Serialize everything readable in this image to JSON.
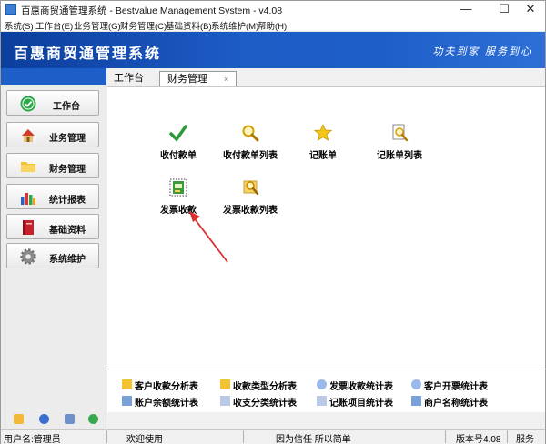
{
  "window": {
    "title": "百惠商贸通管理系统 - Bestvalue Management System - v4.08",
    "controls": {
      "minimize": "—",
      "maximize": "☐",
      "close": "✕"
    }
  },
  "menu": {
    "items": [
      "系统(S)",
      "工作台(E)",
      "业务管理(G)",
      "财务管理(C)",
      "基础资料(B)",
      "系统维护(M)",
      "帮助(H)"
    ]
  },
  "banner": {
    "app_title": "百惠商贸通管理系统",
    "slogan": "功夫到家 服务到心"
  },
  "sidebar": {
    "items": [
      {
        "label": "工作台",
        "icon": "check-circle-icon"
      },
      {
        "label": "业务管理",
        "icon": "house-icon"
      },
      {
        "label": "财务管理",
        "icon": "folder-icon"
      },
      {
        "label": "统计报表",
        "icon": "bar-chart-icon"
      },
      {
        "label": "基础资料",
        "icon": "book-icon"
      },
      {
        "label": "系统维护",
        "icon": "gear-icon"
      }
    ],
    "bottom_icons": [
      "note-icon",
      "clock-icon",
      "window-icon",
      "refresh-icon"
    ]
  },
  "tabs": {
    "workbench": "工作台",
    "finance": "财务管理",
    "close_symbol": "×"
  },
  "tiles": [
    {
      "label": "收付款单",
      "icon": "checkmark-icon"
    },
    {
      "label": "收付款单列表",
      "icon": "magnifier-icon"
    },
    {
      "label": "记账单",
      "icon": "star-icon"
    },
    {
      "label": "记账单列表",
      "icon": "search-doc-icon"
    },
    {
      "label": "发票收款",
      "icon": "invoice-icon"
    },
    {
      "label": "发票收款列表",
      "icon": "invoice-search-icon"
    }
  ],
  "reports": {
    "row1": [
      "客户收款分析表",
      "收款类型分析表",
      "发票收款统计表",
      "客户开票统计表"
    ],
    "row2": [
      "账户余额统计表",
      "收支分类统计表",
      "记账项目统计表",
      "商户名称统计表"
    ]
  },
  "status": {
    "user": "用户名:管理员",
    "welcome": "欢迎使用",
    "motto": "因为信任 所以简单",
    "version": "版本号4.08",
    "extra": "服务"
  },
  "colors": {
    "banner": "#1e5ec8",
    "arrow": "#d93030"
  }
}
